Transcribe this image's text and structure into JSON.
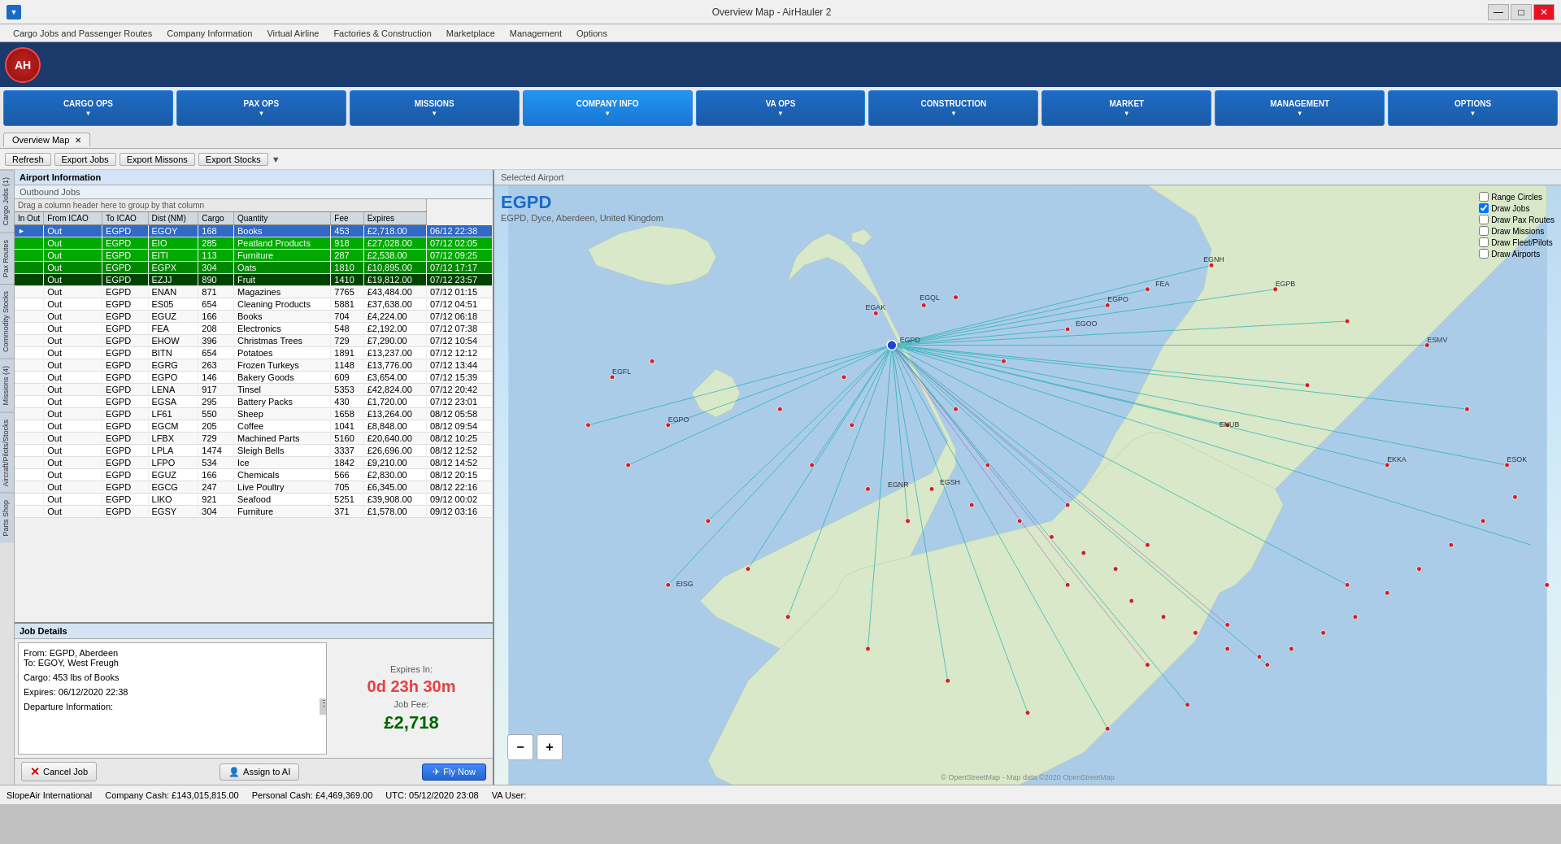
{
  "window": {
    "title": "Overview Map - AirHauler 2",
    "min_label": "—",
    "max_label": "□",
    "close_label": "✕"
  },
  "menubar": {
    "items": [
      "Cargo Jobs and Passenger Routes",
      "Company Information",
      "Virtual Airline",
      "Factories & Construction",
      "Marketplace",
      "Management",
      "Options"
    ]
  },
  "toolbar": {
    "logo": "AH"
  },
  "categories": [
    {
      "id": "cargo-ops",
      "label": "CARGO OPS"
    },
    {
      "id": "pax-ops",
      "label": "PAX OPS"
    },
    {
      "id": "missions",
      "label": "MISSIONS"
    },
    {
      "id": "company-info",
      "label": "COMPANY INFO"
    },
    {
      "id": "va-ops",
      "label": "VA OPS"
    },
    {
      "id": "construction",
      "label": "CONSTRUCTION"
    },
    {
      "id": "market",
      "label": "MARKET"
    },
    {
      "id": "management",
      "label": "MANAGEMENT"
    },
    {
      "id": "options",
      "label": "OPTIONS"
    }
  ],
  "tabs": [
    {
      "label": "Overview Map",
      "active": true
    }
  ],
  "actions": {
    "refresh": "Refresh",
    "export_jobs": "Export Jobs",
    "export_missions": "Export Missons",
    "export_stocks": "Export Stocks"
  },
  "jobs_panel": {
    "header": "Airport Information",
    "subheader": "Outbound Jobs",
    "drag_hint": "Drag a column header here to group by that column",
    "columns": [
      "In Out",
      "From ICAO",
      "To ICAO",
      "Dist (NM)",
      "Cargo",
      "Quantity",
      "Fee",
      "Expires"
    ],
    "rows": [
      {
        "inout": "Out",
        "from": "EGPD",
        "to": "EGOY",
        "dist": "168",
        "cargo": "Books",
        "qty": "453",
        "fee": "£2,718.00",
        "expires": "06/12 22:38",
        "style": "selected"
      },
      {
        "inout": "Out",
        "from": "EGPD",
        "to": "EIO",
        "dist": "285",
        "cargo": "Peatland Products",
        "qty": "918",
        "fee": "£27,028.00",
        "expires": "07/12 02:05",
        "style": "green-bg"
      },
      {
        "inout": "Out",
        "from": "EGPD",
        "to": "EITI",
        "dist": "113",
        "cargo": "Furniture",
        "qty": "287",
        "fee": "£2,538.00",
        "expires": "07/12 09:25",
        "style": "green-bg"
      },
      {
        "inout": "Out",
        "from": "EGPD",
        "to": "EGPX",
        "dist": "304",
        "cargo": "Oats",
        "qty": "1810",
        "fee": "£10,895.00",
        "expires": "07/12 17:17",
        "style": "green-bg2"
      },
      {
        "inout": "Out",
        "from": "EGPD",
        "to": "EZJJ",
        "dist": "890",
        "cargo": "Fruit",
        "qty": "1410",
        "fee": "£19,812.00",
        "expires": "07/12 23:57",
        "style": "green-bg3"
      },
      {
        "inout": "Out",
        "from": "EGPD",
        "to": "ENAN",
        "dist": "871",
        "cargo": "Magazines",
        "qty": "7765",
        "fee": "£43,484.00",
        "expires": "07/12 01:15",
        "style": ""
      },
      {
        "inout": "Out",
        "from": "EGPD",
        "to": "ES05",
        "dist": "654",
        "cargo": "Cleaning Products",
        "qty": "5881",
        "fee": "£37,638.00",
        "expires": "07/12 04:51",
        "style": ""
      },
      {
        "inout": "Out",
        "from": "EGPD",
        "to": "EGUZ",
        "dist": "166",
        "cargo": "Books",
        "qty": "704",
        "fee": "£4,224.00",
        "expires": "07/12 06:18",
        "style": ""
      },
      {
        "inout": "Out",
        "from": "EGPD",
        "to": "FEA",
        "dist": "208",
        "cargo": "Electronics",
        "qty": "548",
        "fee": "£2,192.00",
        "expires": "07/12 07:38",
        "style": ""
      },
      {
        "inout": "Out",
        "from": "EGPD",
        "to": "EHOW",
        "dist": "396",
        "cargo": "Christmas Trees",
        "qty": "729",
        "fee": "£7,290.00",
        "expires": "07/12 10:54",
        "style": ""
      },
      {
        "inout": "Out",
        "from": "EGPD",
        "to": "BITN",
        "dist": "654",
        "cargo": "Potatoes",
        "qty": "1891",
        "fee": "£13,237.00",
        "expires": "07/12 12:12",
        "style": ""
      },
      {
        "inout": "Out",
        "from": "EGPD",
        "to": "EGRG",
        "dist": "263",
        "cargo": "Frozen Turkeys",
        "qty": "1148",
        "fee": "£13,776.00",
        "expires": "07/12 13:44",
        "style": ""
      },
      {
        "inout": "Out",
        "from": "EGPD",
        "to": "EGPO",
        "dist": "146",
        "cargo": "Bakery Goods",
        "qty": "609",
        "fee": "£3,654.00",
        "expires": "07/12 15:39",
        "style": ""
      },
      {
        "inout": "Out",
        "from": "EGPD",
        "to": "LENA",
        "dist": "917",
        "cargo": "Tinsel",
        "qty": "5353",
        "fee": "£42,824.00",
        "expires": "07/12 20:42",
        "style": ""
      },
      {
        "inout": "Out",
        "from": "EGPD",
        "to": "EGSA",
        "dist": "295",
        "cargo": "Battery Packs",
        "qty": "430",
        "fee": "£1,720.00",
        "expires": "07/12 23:01",
        "style": ""
      },
      {
        "inout": "Out",
        "from": "EGPD",
        "to": "LF61",
        "dist": "550",
        "cargo": "Sheep",
        "qty": "1658",
        "fee": "£13,264.00",
        "expires": "08/12 05:58",
        "style": ""
      },
      {
        "inout": "Out",
        "from": "EGPD",
        "to": "EGCM",
        "dist": "205",
        "cargo": "Coffee",
        "qty": "1041",
        "fee": "£8,848.00",
        "expires": "08/12 09:54",
        "style": ""
      },
      {
        "inout": "Out",
        "from": "EGPD",
        "to": "LFBX",
        "dist": "729",
        "cargo": "Machined Parts",
        "qty": "5160",
        "fee": "£20,640.00",
        "expires": "08/12 10:25",
        "style": ""
      },
      {
        "inout": "Out",
        "from": "EGPD",
        "to": "LPLA",
        "dist": "1474",
        "cargo": "Sleigh Bells",
        "qty": "3337",
        "fee": "£26,696.00",
        "expires": "08/12 12:52",
        "style": ""
      },
      {
        "inout": "Out",
        "from": "EGPD",
        "to": "LFPO",
        "dist": "534",
        "cargo": "Ice",
        "qty": "1842",
        "fee": "£9,210.00",
        "expires": "08/12 14:52",
        "style": ""
      },
      {
        "inout": "Out",
        "from": "EGPD",
        "to": "EGUZ",
        "dist": "166",
        "cargo": "Chemicals",
        "qty": "566",
        "fee": "£2,830.00",
        "expires": "08/12 20:15",
        "style": ""
      },
      {
        "inout": "Out",
        "from": "EGPD",
        "to": "EGCG",
        "dist": "247",
        "cargo": "Live Poultry",
        "qty": "705",
        "fee": "£6,345.00",
        "expires": "08/12 22:16",
        "style": ""
      },
      {
        "inout": "Out",
        "from": "EGPD",
        "to": "LIKO",
        "dist": "921",
        "cargo": "Seafood",
        "qty": "5251",
        "fee": "£39,908.00",
        "expires": "09/12 00:02",
        "style": ""
      },
      {
        "inout": "Out",
        "from": "EGPD",
        "to": "EGSY",
        "dist": "304",
        "cargo": "Furniture",
        "qty": "371",
        "fee": "£1,578.00",
        "expires": "09/12 03:16",
        "style": ""
      }
    ]
  },
  "job_details": {
    "header": "Job Details",
    "text_lines": [
      "From: EGPD, Aberdeen",
      "To: EGOY, West Freugh",
      "",
      "Cargo: 453 lbs of Books",
      "",
      "Expires: 06/12/2020 22:38",
      "",
      "Departure Information:"
    ],
    "expires_label": "Expires In:",
    "expires_value": "0d 23h 30m",
    "fee_label": "Job Fee:",
    "fee_value": "£2,718",
    "cancel_label": "Cancel Job",
    "assign_label": "Assign to AI",
    "fly_label": "Fly Now"
  },
  "map": {
    "header": "Selected Airport",
    "airport_code": "EGPD",
    "airport_name": "EGPD, Dyce, Aberdeen, United Kingdom",
    "controls": {
      "range_circles": "Range Circles",
      "draw_jobs": "Draw Jobs",
      "draw_pax": "Draw Pax Routes",
      "draw_missions": "Draw Missions",
      "draw_fleet": "Draw Fleet/Pilots",
      "draw_airports": "Draw Airports"
    },
    "attribution": "© OpenStreetMap - Map data ©2020 OpenStreetMap"
  },
  "left_tabs": [
    "Cargo Jobs (1)",
    "Pax Routes",
    "Commodity Stocks",
    "Missions (4)",
    "Aircraft/Pilots/Stocks",
    "Parts Shop"
  ],
  "statusbar": {
    "company": "SlopeAir International",
    "company_cash": "Company Cash: £143,015,815.00",
    "personal_cash": "Personal Cash: £4,469,369.00",
    "utc": "UTC: 05/12/2020 23:08",
    "va_user": "VA User:"
  },
  "zoom": {
    "minus": "−",
    "plus": "+"
  }
}
